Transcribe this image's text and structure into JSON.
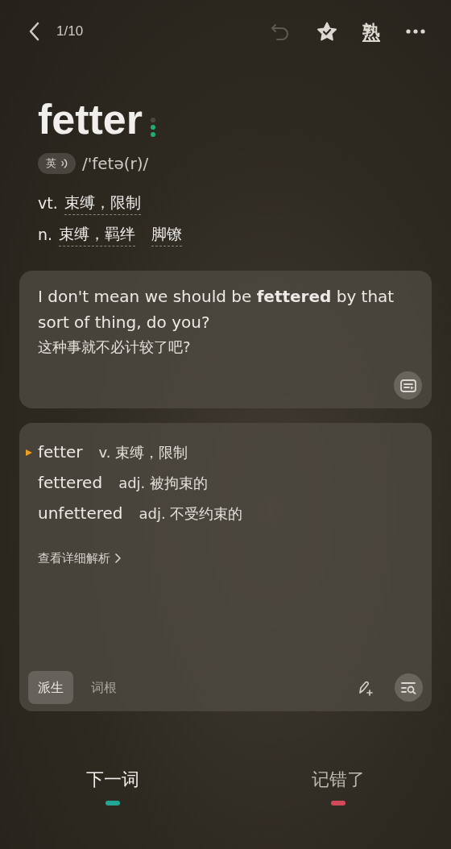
{
  "header": {
    "counter": "1/10",
    "undo": {
      "disabled": true
    },
    "mastered_label": "熟"
  },
  "word": {
    "text": "fetter",
    "accent_label": "英",
    "phonetic": "/'fetə(r)/"
  },
  "meanings": [
    {
      "pos": "vt.",
      "terms": [
        "束缚，限制"
      ]
    },
    {
      "pos": "n.",
      "terms": [
        "束缚，羁绊",
        "脚镣"
      ]
    }
  ],
  "example": {
    "english": "I don't mean we should be **fettered** by that sort of thing, do you?",
    "chinese": "这种事就不必计较了吧?"
  },
  "derivatives": [
    {
      "word": "fetter",
      "meaning": "v. 束缚，限制",
      "current": true
    },
    {
      "word": "fettered",
      "meaning": "adj. 被拘束的",
      "current": false
    },
    {
      "word": "unfettered",
      "meaning": "adj. 不受约束的",
      "current": false
    }
  ],
  "details_link": "查看详细解析",
  "tabs": [
    {
      "label": "派生",
      "selected": true
    },
    {
      "label": "词根",
      "selected": false
    }
  ],
  "actions": [
    {
      "label": "下一词",
      "color": "#22a592"
    },
    {
      "label": "记错了",
      "color": "#d04a5a"
    }
  ]
}
